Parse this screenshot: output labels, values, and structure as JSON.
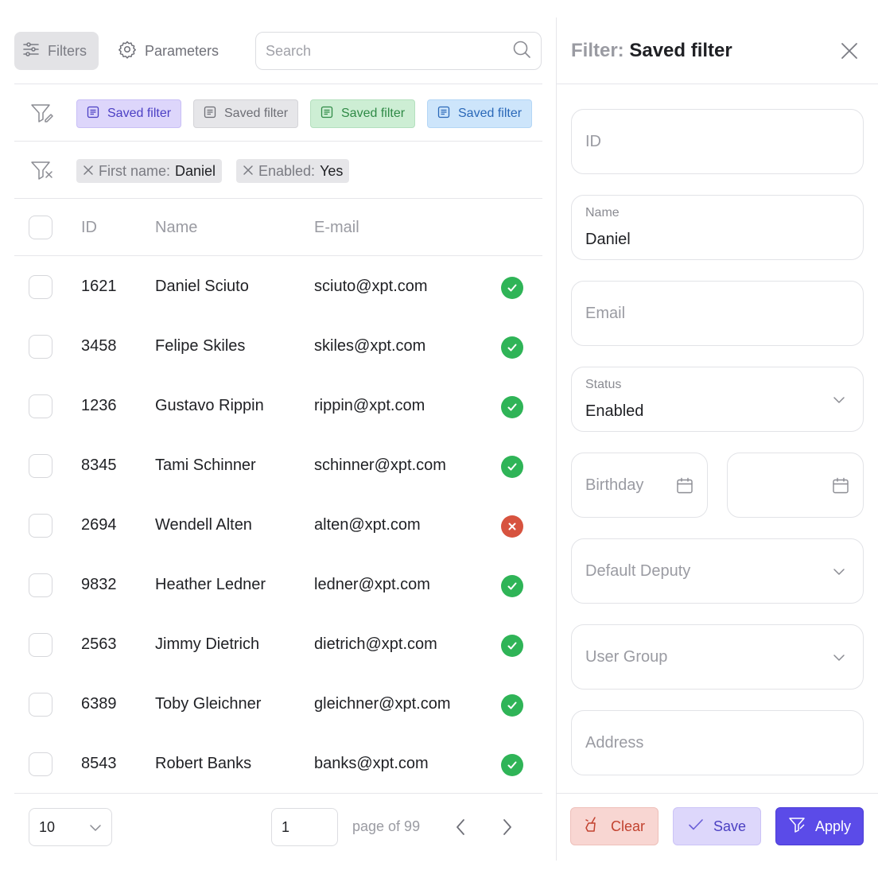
{
  "toolbar": {
    "filters_label": "Filters",
    "parameters_label": "Parameters",
    "search_placeholder": "Search"
  },
  "saved_filters": [
    {
      "label": "Saved filter",
      "color": "#ddd6fb"
    },
    {
      "label": "Saved filter",
      "color": "#e6e6e9"
    },
    {
      "label": "Saved filter",
      "color": "#cdeed4"
    },
    {
      "label": "Saved filter",
      "color": "#cde5fb"
    }
  ],
  "active_filters": [
    {
      "key": "First name:",
      "value": "Daniel"
    },
    {
      "key": "Enabled:",
      "value": "Yes"
    }
  ],
  "table": {
    "columns": [
      "ID",
      "Name",
      "E-mail"
    ],
    "rows": [
      {
        "id": "1621",
        "name": "Daniel Sciuto",
        "email": "sciuto@xpt.com",
        "enabled": true
      },
      {
        "id": "3458",
        "name": "Felipe Skiles",
        "email": "skiles@xpt.com",
        "enabled": true
      },
      {
        "id": "1236",
        "name": "Gustavo Rippin",
        "email": "rippin@xpt.com",
        "enabled": true
      },
      {
        "id": "8345",
        "name": "Tami Schinner",
        "email": "schinner@xpt.com",
        "enabled": true
      },
      {
        "id": "2694",
        "name": "Wendell Alten",
        "email": "alten@xpt.com",
        "enabled": false
      },
      {
        "id": "9832",
        "name": "Heather Ledner",
        "email": "ledner@xpt.com",
        "enabled": true
      },
      {
        "id": "2563",
        "name": "Jimmy Dietrich",
        "email": "dietrich@xpt.com",
        "enabled": true
      },
      {
        "id": "6389",
        "name": "Toby Gleichner",
        "email": "gleichner@xpt.com",
        "enabled": true
      },
      {
        "id": "8543",
        "name": "Robert Banks",
        "email": "banks@xpt.com",
        "enabled": true
      }
    ]
  },
  "pagination": {
    "per_page": "10",
    "current_page": "1",
    "page_of_label": "page of 99"
  },
  "panel": {
    "title_label": "Filter:",
    "title_name": "Saved filter",
    "fields": {
      "id_placeholder": "ID",
      "name_label": "Name",
      "name_value": "Daniel",
      "email_placeholder": "Email",
      "status_label": "Status",
      "status_value": "Enabled",
      "birthday_placeholder": "Birthday",
      "deputy_placeholder": "Default Deputy",
      "user_group_placeholder": "User Group",
      "address_placeholder": "Address"
    },
    "actions": {
      "clear": "Clear",
      "save": "Save",
      "apply": "Apply"
    }
  },
  "colors": {
    "ok": "#2fb457",
    "error": "#d7533f",
    "primary": "#5b4be8",
    "danger_bg": "#f8d6d2"
  }
}
